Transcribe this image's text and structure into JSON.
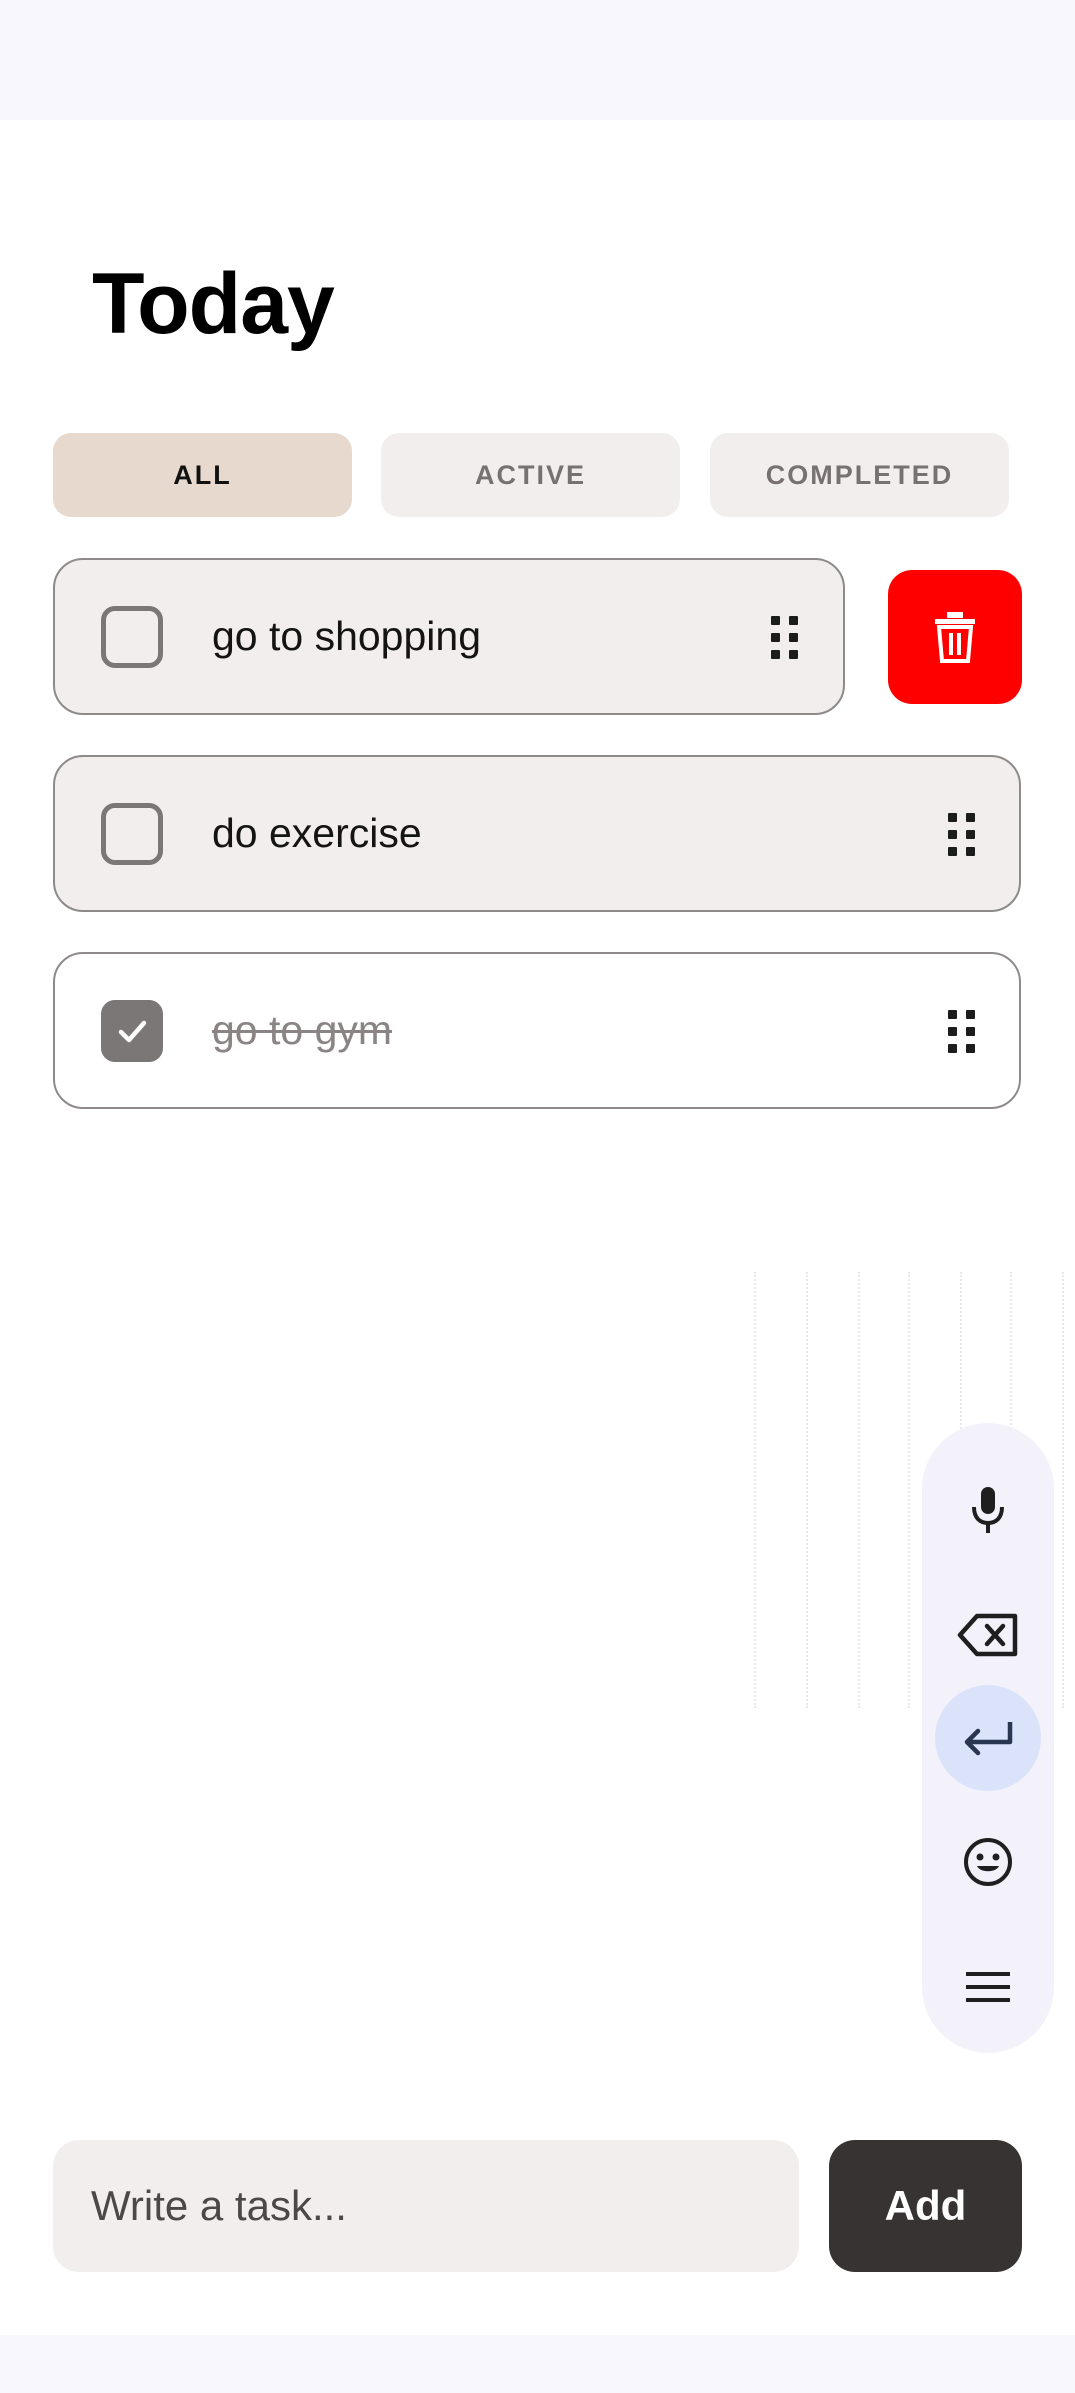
{
  "header": {
    "title": "Today"
  },
  "filters": [
    {
      "label": "ALL",
      "selected": true
    },
    {
      "label": "ACTIVE",
      "selected": false
    },
    {
      "label": "COMPLETED",
      "selected": false
    }
  ],
  "tasks": [
    {
      "text": "go to shopping",
      "completed": false,
      "swiped_for_delete": true
    },
    {
      "text": "do exercise",
      "completed": false,
      "swiped_for_delete": false
    },
    {
      "text": "go to gym",
      "completed": true,
      "swiped_for_delete": false
    }
  ],
  "keyboard_rail": {
    "keys": [
      "mic-icon",
      "backspace-icon",
      "enter-icon",
      "emoji-icon",
      "menu-icon"
    ]
  },
  "composer": {
    "placeholder": "Write a task...",
    "value": "",
    "add_label": "Add"
  },
  "colors": {
    "delete": "#ff0000",
    "selected_filter": "#e7d9cd",
    "card": "#f2eeed",
    "add_button": "#383333"
  }
}
